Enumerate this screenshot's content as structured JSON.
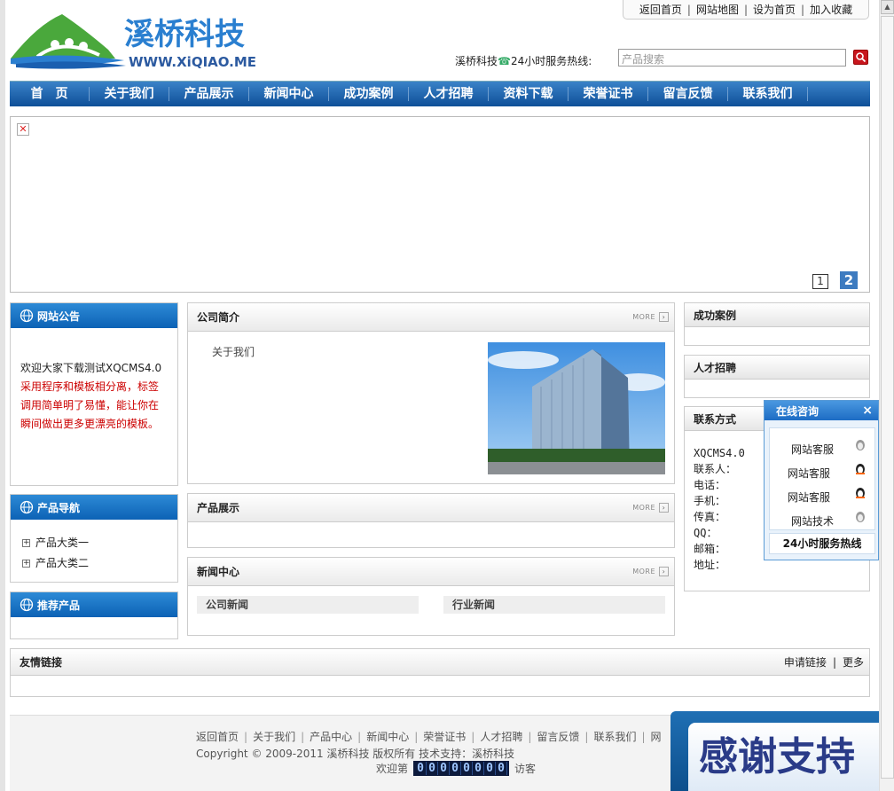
{
  "top_links": [
    "返回首页",
    "网站地图",
    "设为首页",
    "加入收藏"
  ],
  "logo": {
    "cn": "溪桥科技",
    "url_text": "WWW.XiQIAO.ME"
  },
  "hotline": {
    "company": "溪桥科技",
    "label": "24小时服务热线:"
  },
  "search": {
    "placeholder": "产品搜索"
  },
  "nav": [
    "首　页",
    "关于我们",
    "产品展示",
    "新闻中心",
    "成功案例",
    "人才招聘",
    "资料下载",
    "荣誉证书",
    "留言反馈",
    "联系我们"
  ],
  "banner": {
    "pages": [
      "1",
      "2"
    ]
  },
  "announce": {
    "title": "网站公告",
    "line1": "欢迎大家下载测试XQCMS4.0",
    "line2": "采用程序和模板相分离，标签调用简单明了易懂，能让你在瞬间做出更多更漂亮的模板。"
  },
  "product_nav": {
    "title": "产品导航",
    "items": [
      "产品大类一",
      "产品大类二"
    ]
  },
  "recommend": {
    "title": "推荐产品"
  },
  "about": {
    "title": "公司简介",
    "link": "关于我们",
    "more": "MORE"
  },
  "products": {
    "title": "产品展示",
    "more": "MORE"
  },
  "news": {
    "title": "新闻中心",
    "more": "MORE",
    "tabs": [
      "公司新闻",
      "行业新闻"
    ]
  },
  "cases": {
    "title": "成功案例"
  },
  "jobs": {
    "title": "人才招聘"
  },
  "contact": {
    "title": "联系方式",
    "lines": [
      "XQCMS4.0",
      "联系人：",
      "电话：",
      "手机：",
      "传真：",
      "QQ：",
      "邮箱：",
      "地址："
    ]
  },
  "qq": {
    "title": "在线咨询",
    "close": "×",
    "items": [
      "网站客服",
      "网站客服",
      "网站客服",
      "网站技术"
    ],
    "hotline": "24小时服务热线"
  },
  "friend_links": {
    "title": "友情链接",
    "apply": "申请链接",
    "more": "更多"
  },
  "footer": {
    "links": [
      "返回首页",
      "关于我们",
      "产品中心",
      "新闻中心",
      "荣誉证书",
      "人才招聘",
      "留言反馈",
      "联系我们",
      "网"
    ],
    "copy": "Copyright © 2009-2011 溪桥科技 版权所有 技术支持：溪桥科技",
    "visit_pre": "欢迎第",
    "counter": "00000000",
    "visit_post": "访客"
  },
  "thanks": {
    "text": "感谢支持"
  }
}
